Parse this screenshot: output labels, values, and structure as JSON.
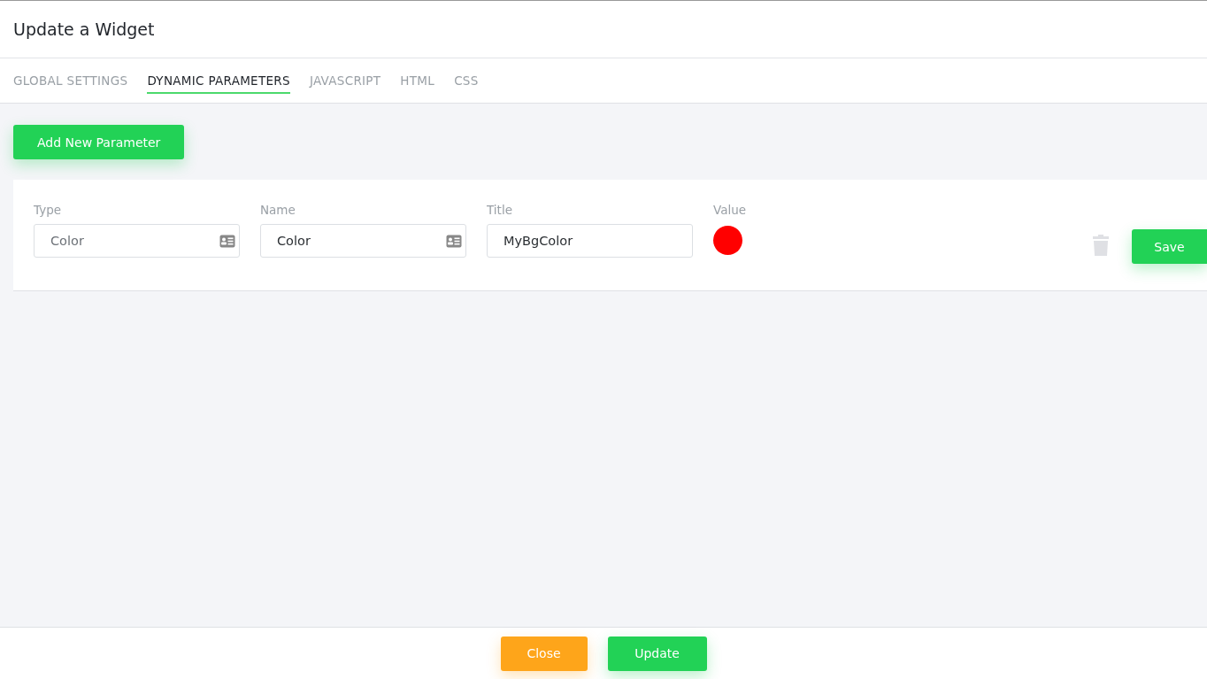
{
  "dialog": {
    "title": "Update a Widget"
  },
  "tabs": [
    {
      "label": "GLOBAL SETTINGS",
      "selected": false
    },
    {
      "label": "DYNAMIC PARAMETERS",
      "selected": true
    },
    {
      "label": "JAVASCRIPT",
      "selected": false
    },
    {
      "label": "HTML",
      "selected": false
    },
    {
      "label": "CSS",
      "selected": false
    }
  ],
  "add_button": "Add New Parameter",
  "parameter": {
    "fields": [
      {
        "label": "Type",
        "kind": "select",
        "value": "Color"
      },
      {
        "label": "Name",
        "kind": "select",
        "value": "Color"
      },
      {
        "label": "Title",
        "kind": "text",
        "value": "MyBgColor"
      }
    ],
    "value_label": "Value",
    "value": {
      "color": "#ff0000"
    },
    "save_button": "Save"
  },
  "footer": {
    "close_button": "Close",
    "update_button": "Update"
  }
}
